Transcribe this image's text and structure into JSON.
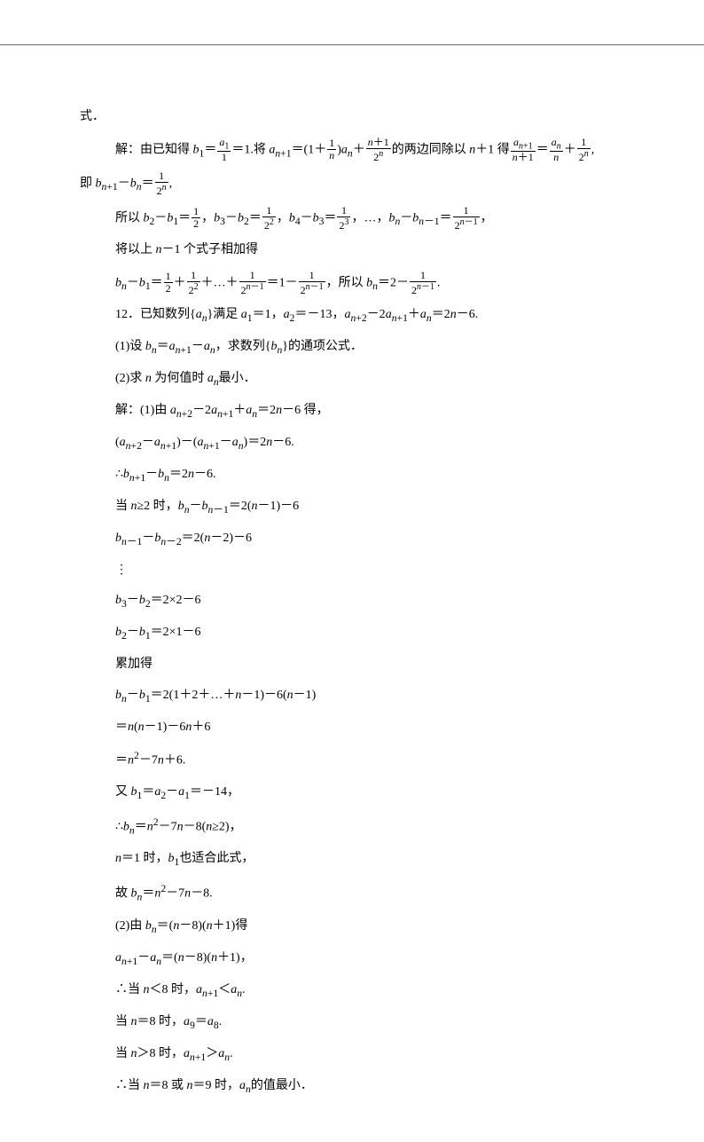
{
  "lines": [
    {
      "cls": "noindent",
      "text": "式．"
    },
    {
      "cls": "indent",
      "html": "解：由已知得 <i>b</i><sub>1</sub>＝<span class='frac'><span class='num'><i>a</i><sub>1</sub></span><span class='den'>1</span></span>＝1.将 <i>a</i><sub><i>n</i>+1</sub>＝(1＋<span class='frac'><span class='num'>1</span><span class='den'><i>n</i></span></span>)<i>a</i><sub><i>n</i></sub>＋<span class='frac'><span class='num'><i>n</i>＋1</span><span class='den'>2<sup><i>n</i></sup></span></span>的两边同除以 <i>n</i>＋1 得<span class='frac'><span class='num'><i>a</i><sub><i>n</i>+1</sub></span><span class='den'><i>n</i>＋1</span></span>＝<span class='frac'><span class='num'><i>a</i><sub><i>n</i></sub></span><span class='den'><i>n</i></span></span>＋<span class='frac'><span class='num'>1</span><span class='den'>2<sup><i>n</i></sup></span></span>,"
    },
    {
      "cls": "noindent",
      "html": "即 <i>b</i><sub><i>n</i>+1</sub>－<i>b</i><sub><i>n</i></sub>＝<span class='frac'><span class='num'>1</span><span class='den'>2<sup><i>n</i></sup></span></span>,"
    },
    {
      "cls": "indent",
      "html": "所以 <i>b</i><sub>2</sub>－<i>b</i><sub>1</sub>＝<span class='frac'><span class='num'>1</span><span class='den'>2</span></span>，<i>b</i><sub>3</sub>－<i>b</i><sub>2</sub>＝<span class='frac'><span class='num'>1</span><span class='den'>2<sup>2</sup></span></span>，<i>b</i><sub>4</sub>－<i>b</i><sub>3</sub>＝<span class='frac'><span class='num'>1</span><span class='den'>2<sup>3</sup></span></span>，…，<i>b</i><sub><i>n</i></sub>－<i>b</i><sub><i>n</i>－1</sub>＝<span class='frac'><span class='num'>1</span><span class='den'>2<sup><i>n</i>－1</sup></span></span>，"
    },
    {
      "cls": "indent",
      "html": "将以上 <i>n</i>－1 个式子相加得"
    },
    {
      "cls": "indent",
      "html": "<i>b</i><sub><i>n</i></sub>－<i>b</i><sub>1</sub>＝<span class='frac'><span class='num'>1</span><span class='den'>2</span></span>＋<span class='frac'><span class='num'>1</span><span class='den'>2<sup>2</sup></span></span>＋…＋<span class='frac'><span class='num'>1</span><span class='den'>2<sup><i>n</i>－1</sup></span></span>＝1－<span class='frac'><span class='num'>1</span><span class='den'>2<sup><i>n</i>－1</sup></span></span>，所以 <i>b</i><sub><i>n</i></sub>＝2－<span class='frac'><span class='num'>1</span><span class='den'>2<sup><i>n</i>－1</sup></span></span>."
    },
    {
      "cls": "indent",
      "html": "12．已知数列{<i>a</i><sub><i>n</i></sub>}满足 <i>a</i><sub>1</sub>＝1，<i>a</i><sub>2</sub>＝－13，<i>a</i><sub><i>n</i>+2</sub>－2<i>a</i><sub><i>n</i>+1</sub>＋<i>a</i><sub><i>n</i></sub>＝2<i>n</i>－6."
    },
    {
      "cls": "indent",
      "html": "(1)设 <i>b</i><sub><i>n</i></sub>＝<i>a</i><sub><i>n</i>+1</sub>－<i>a</i><sub><i>n</i></sub>，求数列{<i>b</i><sub><i>n</i></sub>}的通项公式．"
    },
    {
      "cls": "indent",
      "html": "(2)求 <i>n</i> 为何值时 <i>a</i><sub><i>n</i></sub>最小．"
    },
    {
      "cls": "indent",
      "html": "解：(1)由 <i>a</i><sub><i>n</i>+2</sub>－2<i>a</i><sub><i>n</i>+1</sub>＋<i>a</i><sub><i>n</i></sub>＝2<i>n</i>－6 得，"
    },
    {
      "cls": "indent",
      "html": "(<i>a</i><sub><i>n</i>+2</sub>－<i>a</i><sub><i>n</i>+1</sub>)－(<i>a</i><sub><i>n</i>+1</sub>－<i>a</i><sub><i>n</i></sub>)＝2<i>n</i>－6."
    },
    {
      "cls": "indent",
      "html": "∴<i>b</i><sub><i>n</i>+1</sub>－<i>b</i><sub><i>n</i></sub>＝2<i>n</i>－6."
    },
    {
      "cls": "indent",
      "html": "当 <i>n</i>≥2 时，<i>b</i><sub><i>n</i></sub>－<i>b</i><sub><i>n</i>－1</sub>＝2(<i>n</i>－1)－6"
    },
    {
      "cls": "indent",
      "html": "<i>b</i><sub><i>n</i>－1</sub>－<i>b</i><sub><i>n</i>－2</sub>＝2(<i>n</i>－2)－6"
    },
    {
      "cls": "indent",
      "html": "⋮"
    },
    {
      "cls": "indent",
      "html": "<i>b</i><sub>3</sub>－<i>b</i><sub>2</sub>＝2×2－6"
    },
    {
      "cls": "indent",
      "html": "<i>b</i><sub>2</sub>－<i>b</i><sub>1</sub>＝2×1－6"
    },
    {
      "cls": "indent",
      "text": "累加得"
    },
    {
      "cls": "indent",
      "html": "<i>b</i><sub><i>n</i></sub>－<i>b</i><sub>1</sub>＝2(1＋2＋…＋<i>n</i>－1)－6(<i>n</i>－1)"
    },
    {
      "cls": "indent",
      "html": "＝<i>n</i>(<i>n</i>－1)－6<i>n</i>＋6"
    },
    {
      "cls": "indent",
      "html": "＝<i>n</i><sup>2</sup>－7<i>n</i>＋6."
    },
    {
      "cls": "indent",
      "html": "又 <i>b</i><sub>1</sub>＝<i>a</i><sub>2</sub>－<i>a</i><sub>1</sub>＝－14，"
    },
    {
      "cls": "indent",
      "html": "∴<i>b</i><sub><i>n</i></sub>＝<i>n</i><sup>2</sup>－7<i>n</i>－8(<i>n</i>≥2)，"
    },
    {
      "cls": "indent",
      "html": "<i>n</i>＝1 时，<i>b</i><sub>1</sub>也适合此式，"
    },
    {
      "cls": "indent",
      "html": "故 <i>b</i><sub><i>n</i></sub>＝<i>n</i><sup>2</sup>－7<i>n</i>－8."
    },
    {
      "cls": "indent",
      "html": "(2)由 <i>b</i><sub><i>n</i></sub>＝(<i>n</i>－8)(<i>n</i>＋1)得"
    },
    {
      "cls": "indent",
      "html": "<i>a</i><sub><i>n</i>+1</sub>－<i>a</i><sub><i>n</i></sub>＝(<i>n</i>－8)(<i>n</i>＋1)，"
    },
    {
      "cls": "indent",
      "html": "∴当 <i>n</i>＜8 时，<i>a</i><sub><i>n</i>+1</sub>＜<i>a</i><sub><i>n</i></sub>."
    },
    {
      "cls": "indent",
      "html": "当 <i>n</i>＝8 时，<i>a</i><sub>9</sub>＝<i>a</i><sub>8</sub>."
    },
    {
      "cls": "indent",
      "html": "当 <i>n</i>＞8 时，<i>a</i><sub><i>n</i>+1</sub>＞<i>a</i><sub><i>n</i></sub>."
    },
    {
      "cls": "indent",
      "html": "∴当 <i>n</i>＝8 或 <i>n</i>＝9 时，<i>a</i><sub><i>n</i></sub>的值最小．"
    }
  ]
}
